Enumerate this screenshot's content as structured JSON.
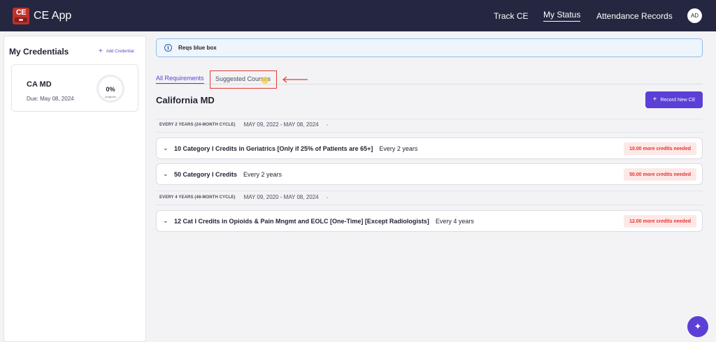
{
  "app": {
    "logo_text": "CE",
    "title": "CE App"
  },
  "nav": {
    "track": "Track CE",
    "status": "My Status",
    "attendance": "Attendance Records",
    "avatar": "AD"
  },
  "sidebar": {
    "title": "My Credentials",
    "add_label": "Add Credential",
    "credential": {
      "name": "CA MD",
      "due": "Due: May 08, 2024",
      "progress_pct": "0%",
      "progress_label": "progress",
      "progress_value": 0
    }
  },
  "info": {
    "text": "Reqs blue box",
    "icon": "info-circle-icon"
  },
  "tabs": {
    "all": "All Requirements",
    "suggested": "Suggested Courses"
  },
  "section": {
    "title": "California MD",
    "record_button": "Record New CE"
  },
  "cycles": [
    {
      "label": "EVERY 2 YEARS (24-MONTH CYCLE)",
      "dates": "MAY 09, 2022 - MAY 08, 2024"
    },
    {
      "label": "EVERY 4 YEARS (48-MONTH CYCLE)",
      "dates": "MAY 09, 2020 - MAY 08, 2024"
    }
  ],
  "requirements": [
    {
      "title": "10 Category I Credits in Geriatrics [Only if 25% of Patients are 65+]",
      "freq": "Every 2 years",
      "badge": "10.00 more credits needed"
    },
    {
      "title": "50 Category I Credits",
      "freq": "Every 2 years",
      "badge": "50.00 more credits needed"
    },
    {
      "title": "12 Cat I Credits in Opioids & Pain Mngmt and EOLC [One-Time] [Except Radiologists]",
      "freq": "Every 4 years",
      "badge": "12.00 more credits needed"
    }
  ],
  "colors": {
    "topbar": "#24273f",
    "accent": "#5b3fd6",
    "danger": "#e0362f",
    "info_border": "#90bde9"
  }
}
